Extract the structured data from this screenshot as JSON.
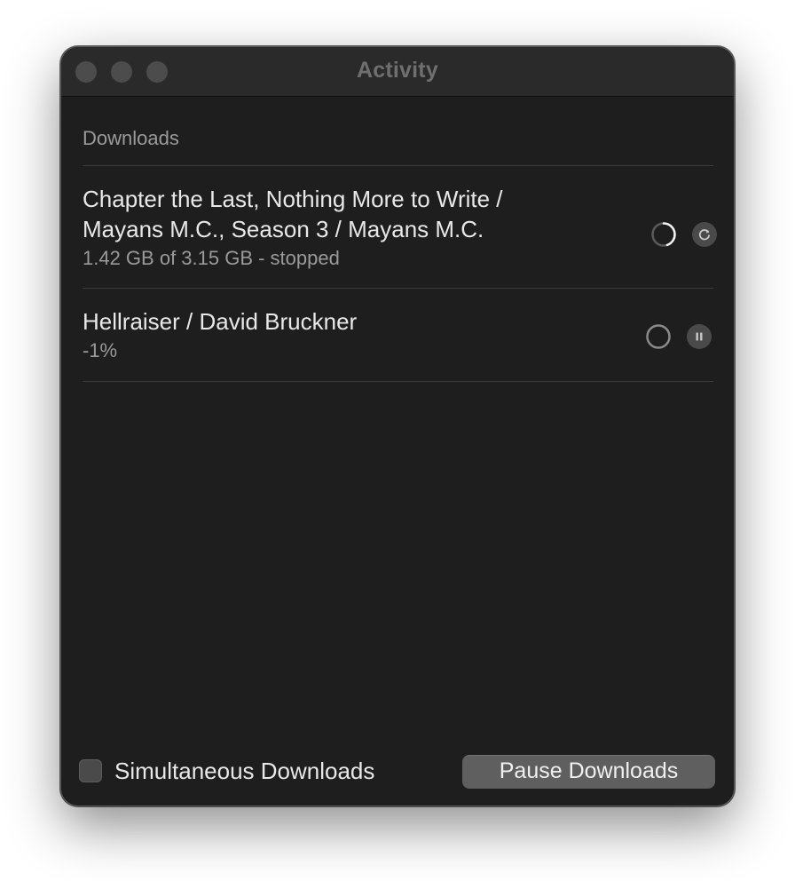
{
  "window": {
    "title": "Activity"
  },
  "downloads": {
    "section_label": "Downloads",
    "items": [
      {
        "title_line1": "Chapter the Last, Nothing More to Write /",
        "title_line2": "Mayans M.C., Season 3 / Mayans M.C.",
        "status": "1.42 GB of 3.15 GB - stopped",
        "progress_fraction": 0.45,
        "action_icon": "refresh-icon"
      },
      {
        "title_line1": "Hellraiser / David Bruckner",
        "status": "-1%",
        "progress_fraction": 0,
        "action_icon": "pause-icon"
      }
    ]
  },
  "footer": {
    "checkbox_label": "Simultaneous Downloads",
    "checkbox_checked": false,
    "pause_button_label": "Pause Downloads"
  },
  "colors": {
    "window_bg": "#1e1e1e",
    "titlebar_bg": "#2a2a2a",
    "text_primary": "#e8e8e8",
    "text_secondary": "#9a9a9a",
    "button_bg": "#5f5f5f"
  }
}
